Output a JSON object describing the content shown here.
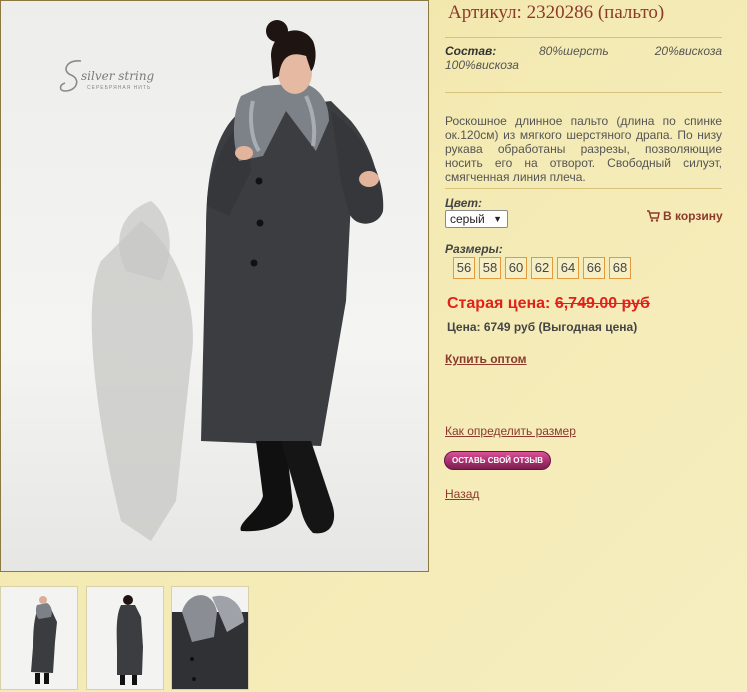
{
  "product": {
    "article_title": "Артикул: 2320286 (пальто)",
    "composition": {
      "label": "Состав:",
      "parts": [
        "80%шерсть",
        "20%вискоза",
        "100%вискоза"
      ]
    },
    "description": "Роскошное длинное пальто (длина по спинке ок.120см) из мягкого шерстяного драпа. По низу рукава обработаны разрезы, позволяющие носить его на отворот. Свободный силуэт, смягченная линия плеча.",
    "color": {
      "label": "Цвет:",
      "selected": "серый",
      "options": [
        "серый"
      ]
    },
    "add_to_cart": "В корзину",
    "sizes": {
      "label": "Размеры:",
      "values": [
        "56",
        "58",
        "60",
        "62",
        "64",
        "66",
        "68"
      ]
    },
    "old_price": {
      "label": "Старая цена:",
      "value": "6,749.00 руб"
    },
    "price": "Цена: 6749 руб (Выгодная цена)",
    "buy_wholesale": "Купить оптом",
    "size_guide": "Как определить размер",
    "review_button": "ОСТАВЬ СВОЙ ОТЗЫВ",
    "back": "Назад"
  },
  "photo": {
    "brand": "silver string",
    "brand_sub": "СЕРЕБРЯНАЯ НИТЬ",
    "thumbnails": [
      "thumb-front",
      "thumb-back",
      "thumb-collar-detail"
    ]
  },
  "colors": {
    "background": "#f1e6a8",
    "title": "#8b3a2c",
    "old_price": "#e0221b",
    "size_border": "#e39a3b",
    "review_button": "#a82e6e"
  }
}
